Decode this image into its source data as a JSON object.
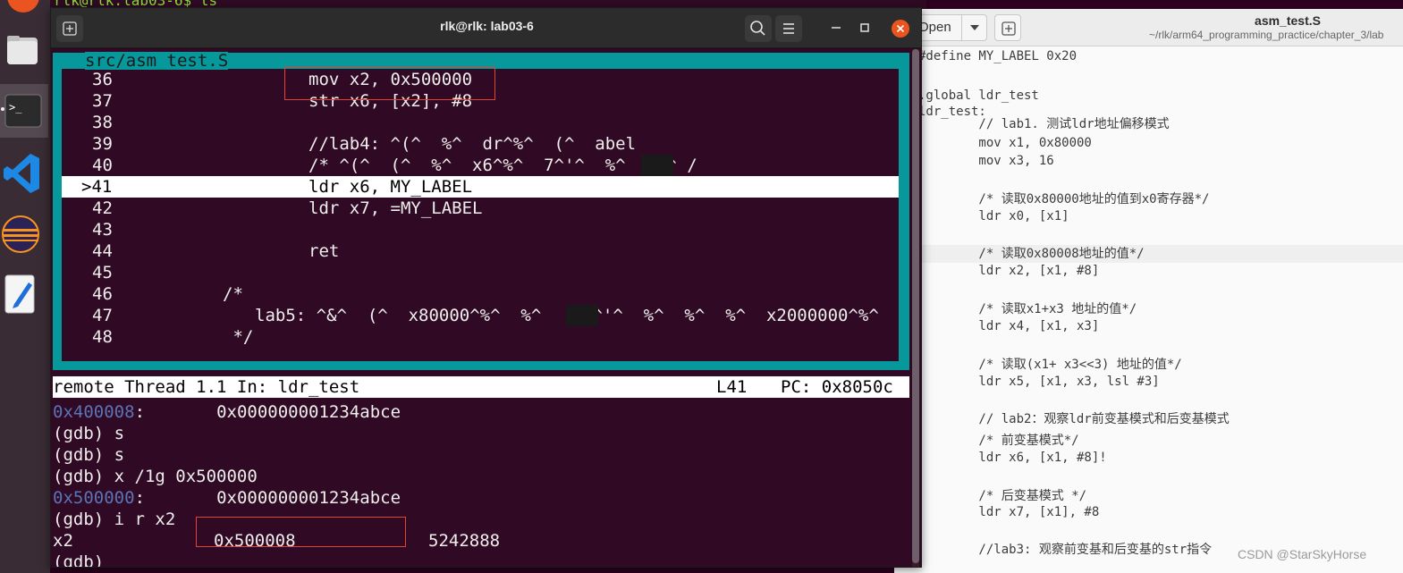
{
  "desktop": {
    "back_terminal_text": "rlk@rlk:lab03-6$ ls",
    "dock": {
      "apps": [
        {
          "name": "files",
          "icon": "files-icon"
        },
        {
          "name": "terminal",
          "icon": "terminal-icon",
          "active": true
        },
        {
          "name": "vscode",
          "icon": "vscode-icon"
        },
        {
          "name": "eclipse",
          "icon": "eclipse-icon"
        },
        {
          "name": "text-editor",
          "icon": "text-editor-icon"
        }
      ]
    }
  },
  "terminal": {
    "title": "rlk@rlk: lab03-6",
    "source_pane": {
      "filename": "src/asm_test.S",
      "lines": [
        {
          "num": "36",
          "code": "mov x2, 0x500000"
        },
        {
          "num": "37",
          "code": "str x6, [x2], #8"
        },
        {
          "num": "38",
          "code": ""
        },
        {
          "num": "39",
          "code": "//lab4: ^(^  %^  dr^%^  (^  abel"
        },
        {
          "num": "40",
          "code": "/* ^(^  (^  %^  x6^%^  7^'^  %^    ^ /"
        },
        {
          "num": ">41",
          "code": "ldr x6, MY_LABEL"
        },
        {
          "num": "42",
          "code": "ldr x7, =MY_LABEL"
        },
        {
          "num": "43",
          "code": ""
        },
        {
          "num": "44",
          "code": "ret"
        },
        {
          "num": "45",
          "code": ""
        },
        {
          "num": "46",
          "code": "/*"
        },
        {
          "num": "47",
          "code": "lab5: ^&^  (^  x80000^%^  %^     ^'^  %^  %^  %^  x2000000^%^"
        },
        {
          "num": "48",
          "code": " */"
        }
      ]
    },
    "status_bar": {
      "thread": "remote Thread 1.1 In: ldr_test",
      "line": "L41",
      "pc": "PC: 0x8050c"
    },
    "console": [
      {
        "addr": "0x400008",
        "text": ":       0x000000001234abce"
      },
      {
        "text": "(gdb) s"
      },
      {
        "text": "(gdb) s"
      },
      {
        "text": "(gdb) x /1g 0x500000"
      },
      {
        "addr": "0x500000",
        "text": ":       0x000000001234abce"
      },
      {
        "text": "(gdb) i r x2"
      },
      {
        "text": "x2",
        "value": "0x500008",
        "decimal": "5242888"
      },
      {
        "text": "(gdb)"
      }
    ],
    "highlight_color": "#e34234"
  },
  "gedit": {
    "open_label": "Open",
    "title": "asm_test.S",
    "path": "~/rlk/arm64_programming_practice/chapter_3/lab",
    "lines": [
      "#define MY_LABEL 0x20",
      "",
      ".global ldr_test",
      "ldr_test:",
      "        // lab1. 测试ldr地址偏移模式",
      "        mov x1, 0x80000",
      "        mov x3, 16",
      "",
      "        /* 读取0x80000地址的值到x0寄存器*/",
      "        ldr x0, [x1]",
      "",
      "        /* 读取0x80008地址的值*/",
      "        ldr x2, [x1, #8]",
      "",
      "        /* 读取x1+x3 地址的值*/",
      "        ldr x4, [x1, x3]",
      "",
      "        /* 读取(x1+ x3<<3) 地址的值*/",
      "        ldr x5, [x1, x3, lsl #3]",
      "",
      "        // lab2：观察ldr前变基模式和后变基模式",
      "        /* 前变基模式*/",
      "        ldr x6, [x1, #8]!",
      "",
      "        /* 后变基模式 */",
      "        ldr x7, [x1], #8",
      "",
      "        //lab3: 观察前变基和后变基的str指令"
    ],
    "current_line_index": 11,
    "watermark": "CSDN @StarSkyHorse"
  }
}
